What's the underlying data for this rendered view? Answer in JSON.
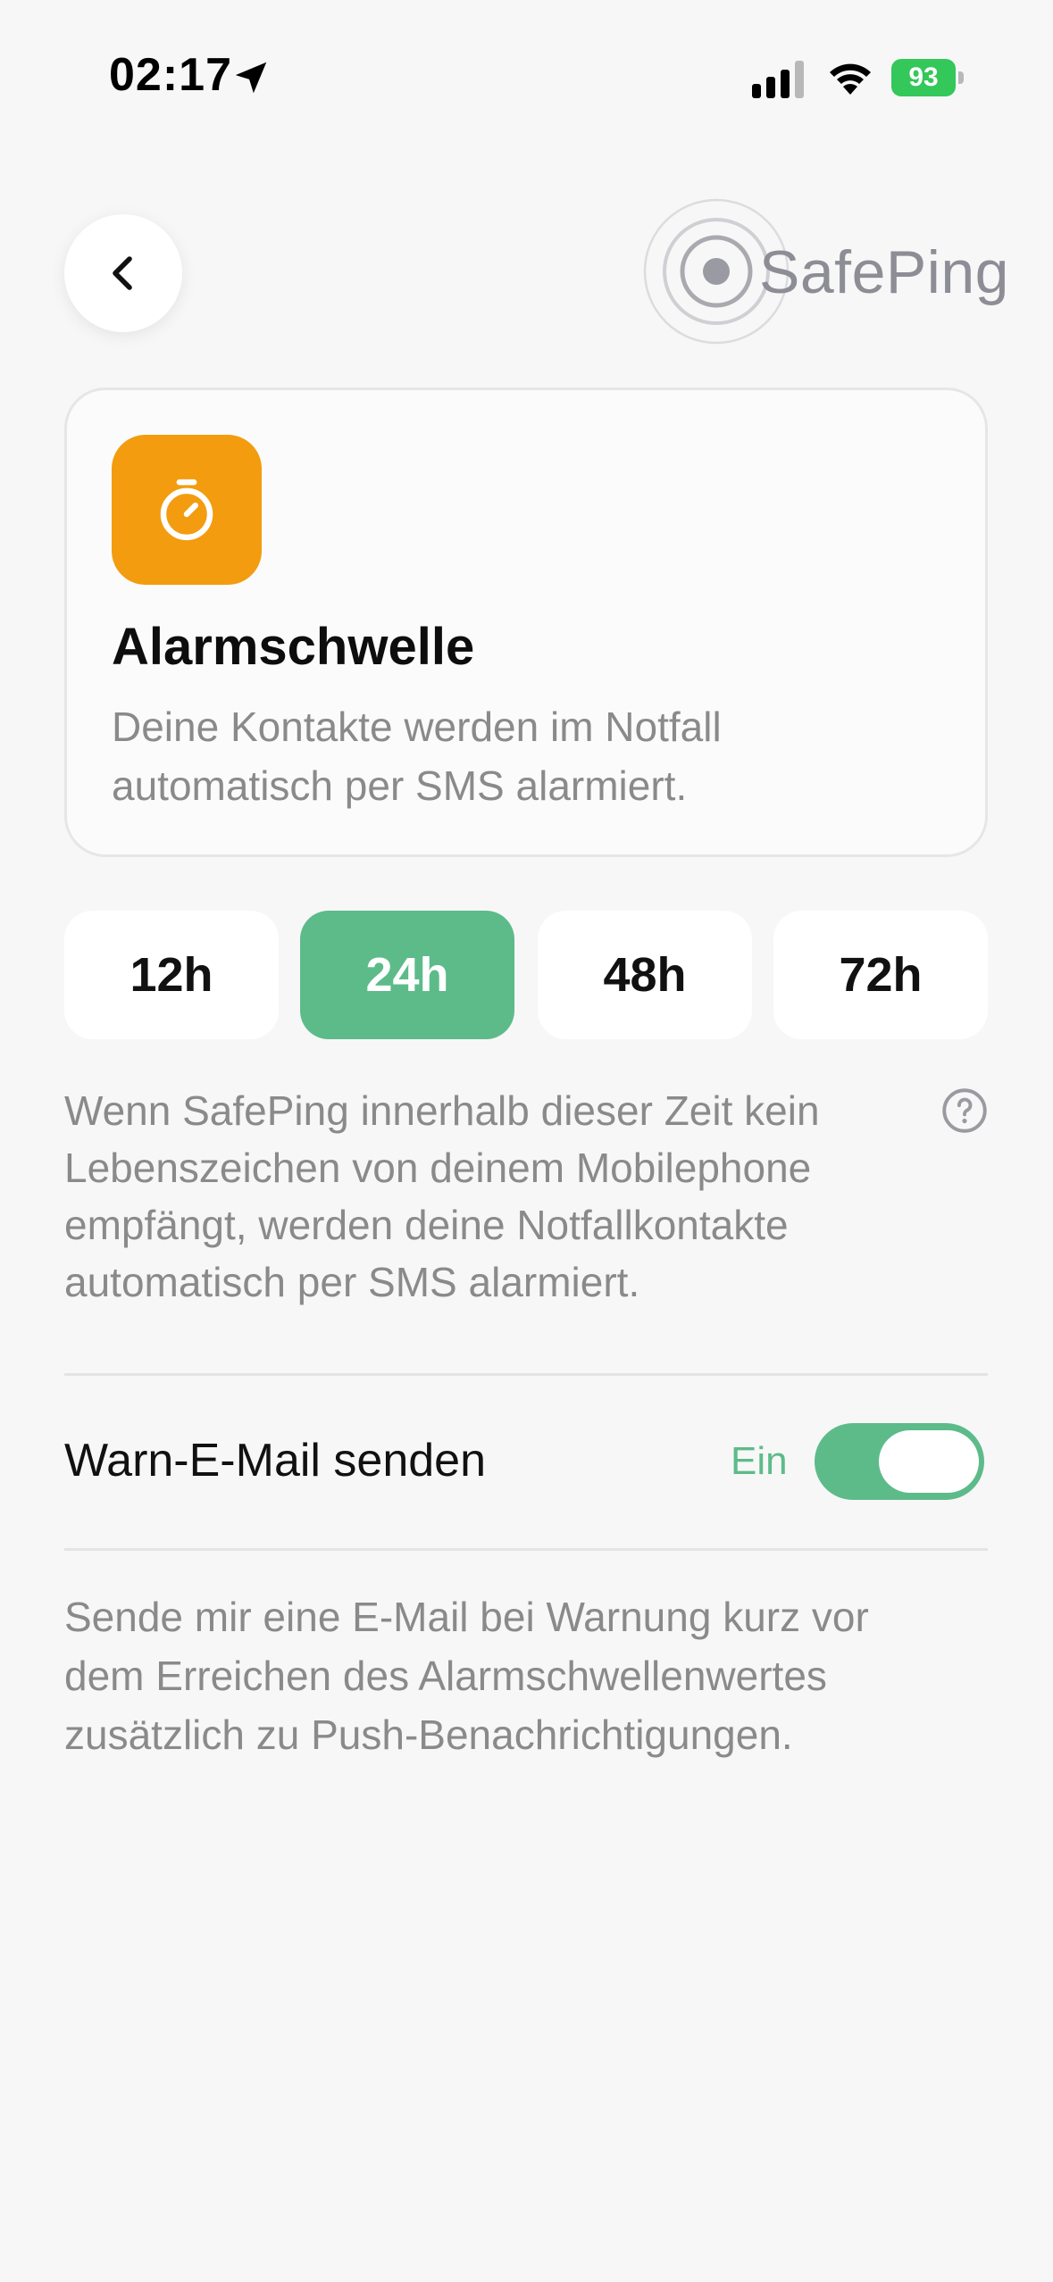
{
  "status_bar": {
    "time": "02:17",
    "battery": "93",
    "icons": [
      "location-arrow-icon",
      "signal-icon",
      "wifi-icon",
      "battery-icon"
    ]
  },
  "header": {
    "logo_text": "SafePing",
    "back_icon": "chevron-left-icon"
  },
  "card": {
    "icon": "stopwatch-icon",
    "title": "Alarmschwelle",
    "description": "Deine Kontakte werden im Notfall automatisch per SMS alarmiert."
  },
  "threshold": {
    "options": [
      "12h",
      "24h",
      "48h",
      "72h"
    ],
    "selected": "24h",
    "help_text": "Wenn SafePing innerhalb dieser Zeit kein Lebenszeichen von deinem Mobilephone empfängt, werden deine Notfallkontakte automatisch per SMS alarmiert."
  },
  "warn_email": {
    "label": "Warn-E-Mail senden",
    "state_label": "Ein",
    "enabled": true,
    "description": "Sende mir eine E-Mail bei Warnung kurz vor dem Erreichen des Alarmschwellenwertes zusätzlich zu Push-Benachrichtigungen."
  },
  "colors": {
    "accent_green": "#5dbb8a",
    "icon_orange": "#f39c0f",
    "battery_green": "#34c759"
  }
}
